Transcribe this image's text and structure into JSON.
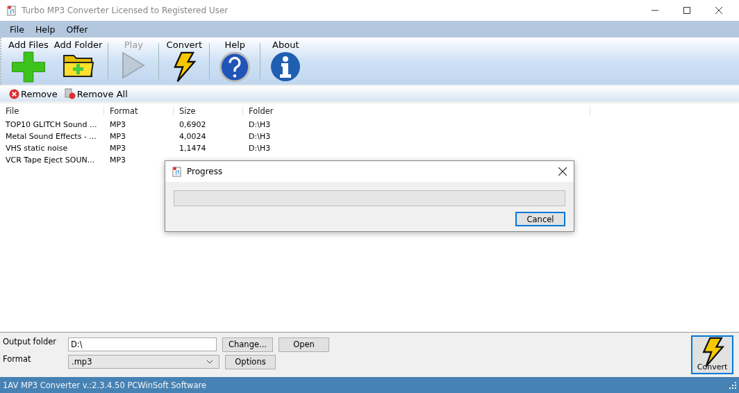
{
  "window": {
    "title": "Turbo MP3 Converter Licensed to Registered User"
  },
  "menu": [
    "File",
    "Help",
    "Offer"
  ],
  "toolbar": [
    {
      "label": "Add Files",
      "kind": "add",
      "disabled": false
    },
    {
      "label": "Add Folder",
      "kind": "folder",
      "disabled": false
    },
    {
      "label": "Play",
      "kind": "play",
      "disabled": true
    },
    {
      "label": "Convert",
      "kind": "convert",
      "disabled": false
    },
    {
      "label": "Help",
      "kind": "help",
      "disabled": false
    },
    {
      "label": "About",
      "kind": "about",
      "disabled": false
    }
  ],
  "list_toolbar": [
    {
      "label": "Remove",
      "kind": "remove"
    },
    {
      "label": "Remove All",
      "kind": "remove_all"
    }
  ],
  "table": {
    "columns": [
      "File",
      "Format",
      "Size",
      "Folder"
    ],
    "rows": [
      {
        "file": "TOP10 GLITCH Sound ...",
        "format": "MP3",
        "size": "0,6902",
        "folder": "D:\\H3"
      },
      {
        "file": "Metal Sound Effects - ...",
        "format": "MP3",
        "size": "4,0024",
        "folder": "D:\\H3"
      },
      {
        "file": "VHS static noise",
        "format": "MP3",
        "size": "1,1474",
        "folder": "D:\\H3"
      },
      {
        "file": "VCR Tape Eject SOUN...",
        "format": "MP3"
      }
    ]
  },
  "output": {
    "folder_label": "Output folder",
    "folder_value": "D:\\",
    "format_label": "Format",
    "format_value": ".mp3",
    "change_button": "Change...",
    "open_button": "Open",
    "options_button": "Options",
    "convert_button": "Convert"
  },
  "status_bar": "1AV MP3 Converter v.:2.3.4.50 PCWinSoft Software",
  "dialog": {
    "title": "Progress",
    "level": 0,
    "cancel_button": "Cancel"
  }
}
